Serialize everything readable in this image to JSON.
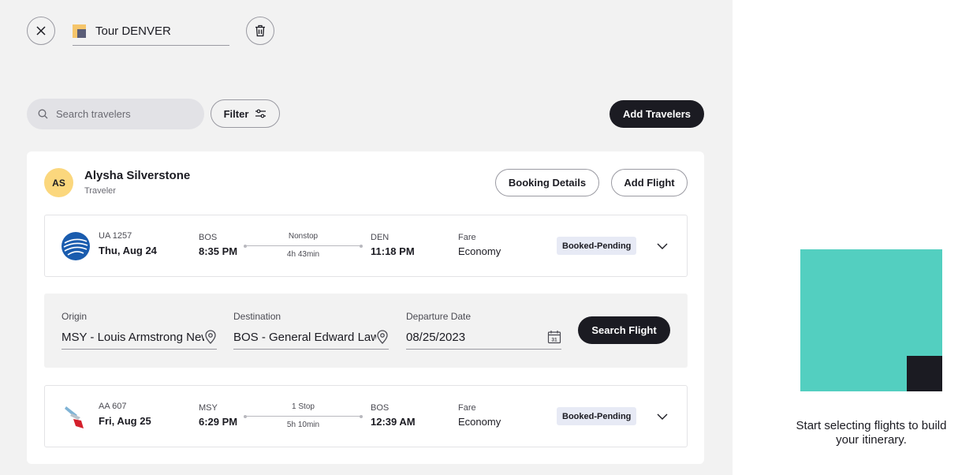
{
  "header": {
    "trip_name": "Tour DENVER"
  },
  "toolbar": {
    "search_placeholder": "Search travelers",
    "filter_label": "Filter",
    "add_travelers_label": "Add Travelers"
  },
  "traveler": {
    "initials": "AS",
    "name": "Alysha Silverstone",
    "role": "Traveler",
    "booking_details_label": "Booking Details",
    "add_flight_label": "Add Flight"
  },
  "flights": [
    {
      "code": "UA 1257",
      "date": "Thu, Aug 24",
      "from_airport": "BOS",
      "from_time": "8:35 PM",
      "stops": "Nonstop",
      "duration": "4h 43min",
      "to_airport": "DEN",
      "to_time": "11:18 PM",
      "fare_label": "Fare",
      "fare": "Economy",
      "status": "Booked-Pending"
    },
    {
      "code": "AA 607",
      "date": "Fri, Aug 25",
      "from_airport": "MSY",
      "from_time": "6:29 PM",
      "stops": "1 Stop",
      "duration": "5h 10min",
      "to_airport": "BOS",
      "to_time": "12:39 AM",
      "fare_label": "Fare",
      "fare": "Economy",
      "status": "Booked-Pending"
    }
  ],
  "flight_search": {
    "origin_label": "Origin",
    "origin_value": "MSY - Louis Armstrong New Orleans",
    "destination_label": "Destination",
    "destination_value": "BOS - General Edward Lawrence Logan",
    "date_label": "Departure Date",
    "date_value": "08/25/2023",
    "calendar_day": "31",
    "search_label": "Search Flight"
  },
  "itinerary": {
    "empty_message": "Start selecting flights to build your itinerary."
  },
  "colors": {
    "accent_dark": "#1b1b22",
    "teal": "#53cfc0",
    "avatar_yellow": "#fbd77d",
    "badge_bg": "#e7eaf5"
  },
  "icons": {
    "close": "close-icon",
    "trash": "trash-icon",
    "search": "search-icon",
    "filter": "sliders-icon",
    "location": "location-pin-icon",
    "calendar": "calendar-icon",
    "chevron": "chevron-down-icon"
  }
}
